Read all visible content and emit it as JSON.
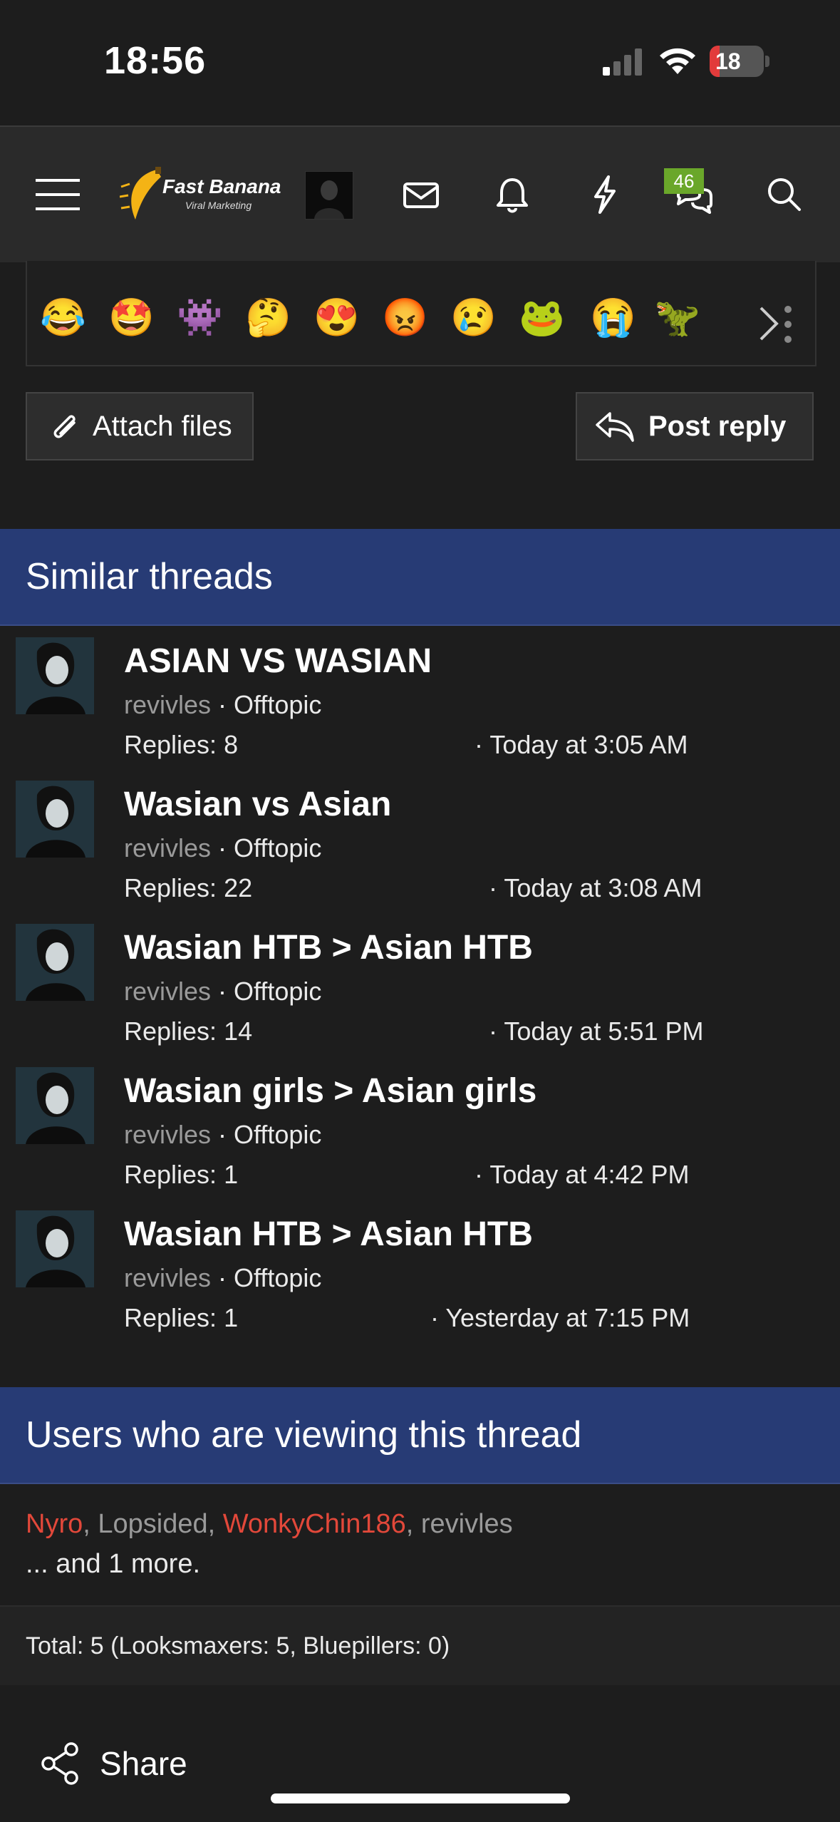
{
  "status": {
    "time": "18:56",
    "battery": "18"
  },
  "nav": {
    "logo_title": "Fast Banana",
    "logo_sub": "Viral Marketing",
    "chat_badge": "46"
  },
  "emojis": [
    "😂",
    "🤩",
    "👾",
    "🤔",
    "😍",
    "😡",
    "😢",
    "🐸",
    "😭",
    "🦖"
  ],
  "editor": {
    "attach_label": "Attach files",
    "reply_label": "Post reply"
  },
  "similar": {
    "heading": "Similar threads",
    "threads": [
      {
        "title": "ASIAN VS WASIAN",
        "author": "revivles",
        "forum": "Offtopic",
        "replies": "Replies: 8",
        "date": "· Today at 3:05 AM"
      },
      {
        "title": "Wasian vs Asian",
        "author": "revivles",
        "forum": "Offtopic",
        "replies": "Replies: 22",
        "date": "· Today at 3:08 AM"
      },
      {
        "title": "Wasian HTB > Asian HTB",
        "author": "revivles",
        "forum": "Offtopic",
        "replies": "Replies: 14",
        "date": "· Today at 5:51 PM"
      },
      {
        "title": "Wasian girls > Asian girls",
        "author": "revivles",
        "forum": "Offtopic",
        "replies": "Replies: 1",
        "date": "· Today at 4:42 PM"
      },
      {
        "title": "Wasian HTB > Asian HTB",
        "author": "revivles",
        "forum": "Offtopic",
        "replies": "Replies: 1",
        "date": "· Yesterday at 7:15 PM"
      }
    ]
  },
  "viewing": {
    "heading": "Users who are viewing this thread",
    "users": [
      "Nyro",
      "Lopsided",
      "WonkyChin186",
      "revivles"
    ],
    "more": "... and 1 more.",
    "total": "Total: 5 (Looksmaxers: 5, Bluepillers: 0)"
  },
  "share": {
    "label": "Share"
  },
  "colors": {
    "header_bg": "#273b75",
    "highlight_user": "#e2483a",
    "badge": "#6aa72a"
  }
}
